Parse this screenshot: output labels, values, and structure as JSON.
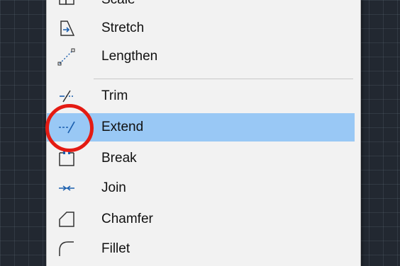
{
  "menu": {
    "items": [
      {
        "label": "Scale",
        "icon": "scale-icon"
      },
      {
        "label": "Stretch",
        "icon": "stretch-icon"
      },
      {
        "label": "Lengthen",
        "icon": "lengthen-icon"
      },
      {
        "label": "Trim",
        "icon": "trim-icon"
      },
      {
        "label": "Extend",
        "icon": "extend-icon",
        "selected": true
      },
      {
        "label": "Break",
        "icon": "break-icon"
      },
      {
        "label": "Join",
        "icon": "join-icon"
      },
      {
        "label": "Chamfer",
        "icon": "chamfer-icon"
      },
      {
        "label": "Fillet",
        "icon": "fillet-icon"
      }
    ]
  },
  "colors": {
    "canvas": "#222831",
    "menu_bg": "#f2f2f2",
    "selection": "#99c8f5",
    "icon_blue": "#1b5fae",
    "annotation_ring": "#e41b13"
  }
}
